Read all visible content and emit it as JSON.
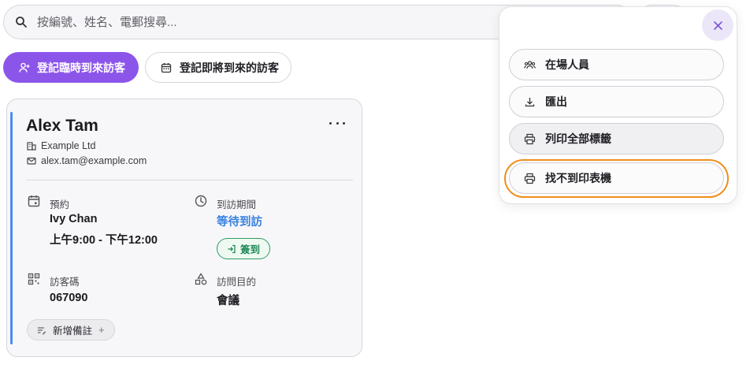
{
  "search": {
    "placeholder": "按編號、姓名、電郵搜尋..."
  },
  "toolbar": {
    "register_now_label": "登記臨時到來訪客",
    "register_upcoming_label": "登記即將到來的訪客"
  },
  "visitor_card": {
    "name": "Alex Tam",
    "company": "Example Ltd",
    "email": "alex.tam@example.com",
    "appointment_label": "預約",
    "host": "Ivy Chan",
    "time": "上午9:00 - 下午12:00",
    "visit_period_label": "到訪期間",
    "visit_status": "等待到訪",
    "checkin_label": "簽到",
    "visitor_code_label": "訪客碼",
    "visitor_code": "067090",
    "purpose_label": "訪問目的",
    "purpose": "會議",
    "add_note_label": "新增備註",
    "add_note_plus": "+"
  },
  "menu": {
    "items": [
      {
        "label": "在場人員",
        "icon": "people-icon"
      },
      {
        "label": "匯出",
        "icon": "download-icon"
      },
      {
        "label": "列印全部標籤",
        "icon": "printer-icon"
      },
      {
        "label": "找不到印表機",
        "icon": "printer-icon"
      }
    ]
  },
  "colors": {
    "primary": "#8c55ea",
    "link": "#3a82e0",
    "success": "#1f8a55",
    "focus": "#ef8e1c",
    "accent_bar": "#4a8ee8"
  }
}
